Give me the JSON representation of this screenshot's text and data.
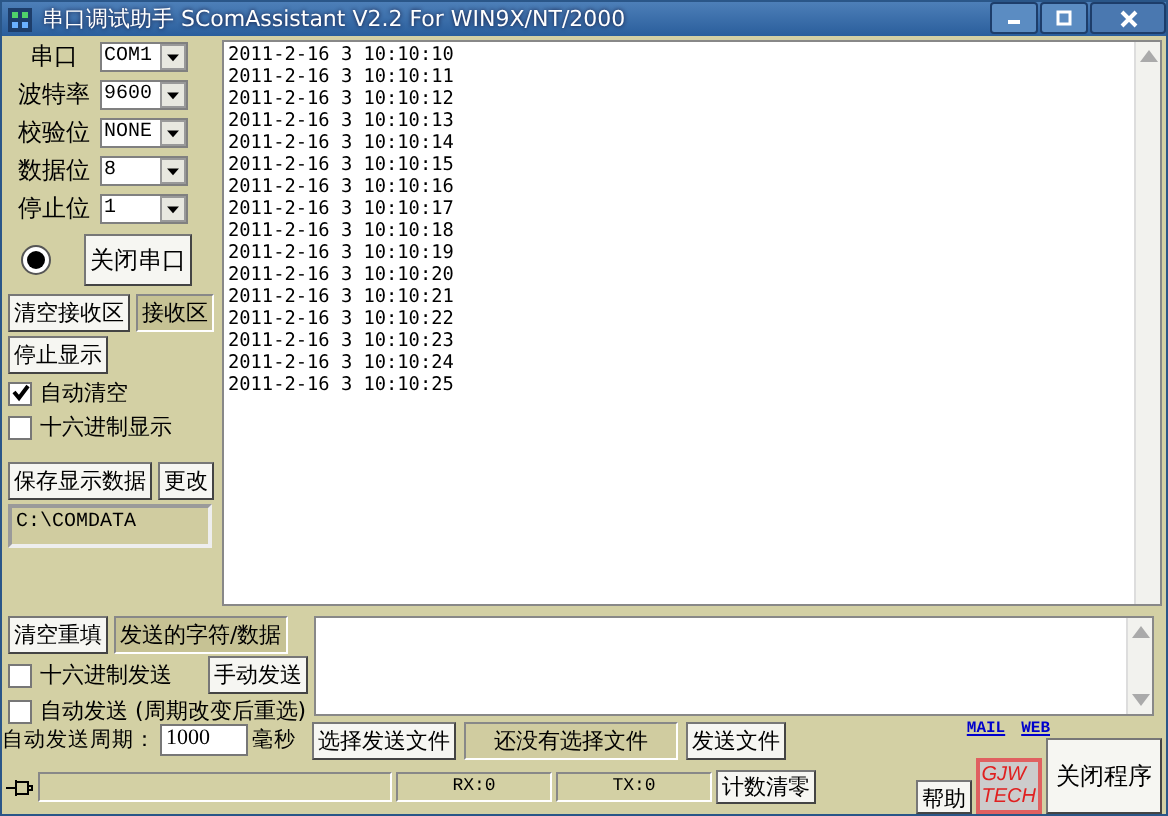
{
  "window": {
    "title": "串口调试助手 SComAssistant V2.2 For WIN9X/NT/2000"
  },
  "settings": [
    {
      "label": "串口",
      "value": "COM1"
    },
    {
      "label": "波特率",
      "value": "9600"
    },
    {
      "label": "校验位",
      "value": "NONE"
    },
    {
      "label": "数据位",
      "value": "8"
    },
    {
      "label": "停止位",
      "value": "1"
    }
  ],
  "port": {
    "open": true,
    "button": "关闭串口"
  },
  "receive": {
    "clear_button": "清空接收区",
    "label": "接收区",
    "stop_button": "停止显示",
    "options": [
      {
        "label": "自动清空",
        "checked": true
      },
      {
        "label": "十六进制显示",
        "checked": false
      }
    ],
    "save_button": "保存显示数据",
    "change_button": "更改",
    "path": "C:\\COMDATA",
    "lines": [
      "2011-2-16 3 10:10:10",
      "2011-2-16 3 10:10:11",
      "2011-2-16 3 10:10:12",
      "2011-2-16 3 10:10:13",
      "2011-2-16 3 10:10:14",
      "2011-2-16 3 10:10:15",
      "2011-2-16 3 10:10:16",
      "2011-2-16 3 10:10:17",
      "2011-2-16 3 10:10:18",
      "2011-2-16 3 10:10:19",
      "2011-2-16 3 10:10:20",
      "2011-2-16 3 10:10:21",
      "2011-2-16 3 10:10:22",
      "2011-2-16 3 10:10:23",
      "2011-2-16 3 10:10:24",
      "2011-2-16 3 10:10:25"
    ]
  },
  "send": {
    "clear_button": "清空重填",
    "label": "发送的字符/数据",
    "hex_send": {
      "label": "十六进制发送",
      "checked": false
    },
    "manual_button": "手动发送",
    "auto_send": {
      "label": "自动发送 (周期改变后重选)",
      "checked": false
    },
    "period_label": "自动发送周期：",
    "period": "1000",
    "period_unit": "毫秒",
    "select_file_button": "选择发送文件",
    "file_status": "还没有选择文件",
    "send_file_button": "发送文件"
  },
  "links": [
    "MAIL",
    "WEB"
  ],
  "logo": {
    "line_1": "GJW",
    "line_2": "TECH"
  },
  "help_button": "帮助",
  "close_button": "关闭程序",
  "status_bar": {
    "rx": "RX:0",
    "tx": "TX:0",
    "reset_button": "计数清零"
  }
}
